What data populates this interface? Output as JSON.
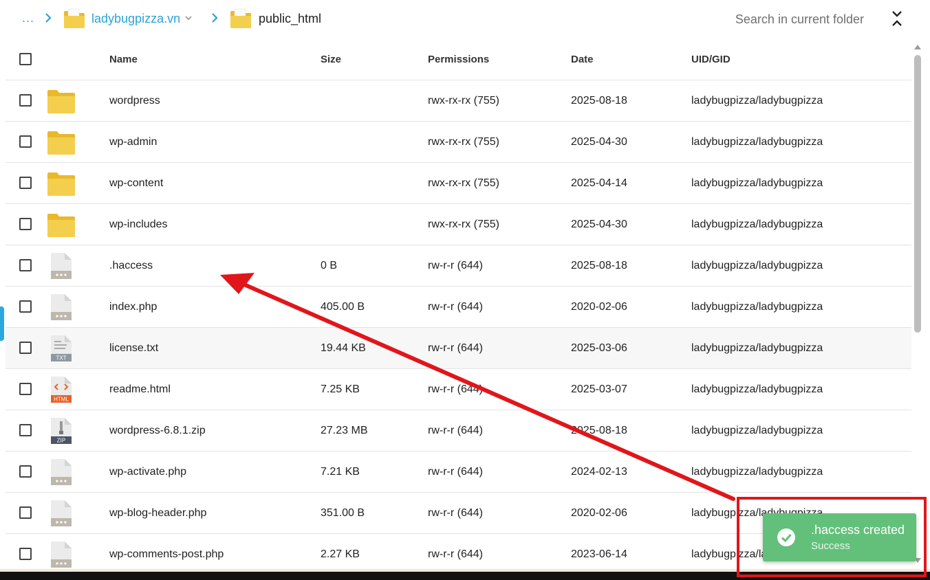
{
  "breadcrumb": {
    "ellipsis": "...",
    "domain": "ladybugpizza.vn",
    "current": "public_html"
  },
  "search": {
    "placeholder": "Search in current folder"
  },
  "columns": {
    "name": "Name",
    "size": "Size",
    "permissions": "Permissions",
    "date": "Date",
    "uid_gid": "UID/GID"
  },
  "files": [
    {
      "icon": "folder-icon",
      "name": "wordpress",
      "size": "",
      "permissions": "rwx-rx-rx (755)",
      "date": "2025-08-18",
      "uid": "ladybugpizza/ladybugpizza"
    },
    {
      "icon": "folder-icon",
      "name": "wp-admin",
      "size": "",
      "permissions": "rwx-rx-rx (755)",
      "date": "2025-04-30",
      "uid": "ladybugpizza/ladybugpizza"
    },
    {
      "icon": "folder-icon",
      "name": "wp-content",
      "size": "",
      "permissions": "rwx-rx-rx (755)",
      "date": "2025-04-14",
      "uid": "ladybugpizza/ladybugpizza"
    },
    {
      "icon": "folder-icon",
      "name": "wp-includes",
      "size": "",
      "permissions": "rwx-rx-rx (755)",
      "date": "2025-04-30",
      "uid": "ladybugpizza/ladybugpizza"
    },
    {
      "icon": "generic-file-icon",
      "name": ".haccess",
      "size": "0 B",
      "permissions": "rw-r-r (644)",
      "date": "2025-08-18",
      "uid": "ladybugpizza/ladybugpizza"
    },
    {
      "icon": "generic-file-icon",
      "name": "index.php",
      "size": "405.00 B",
      "permissions": "rw-r-r (644)",
      "date": "2020-02-06",
      "uid": "ladybugpizza/ladybugpizza"
    },
    {
      "icon": "txt-file-icon",
      "name": "license.txt",
      "size": "19.44 KB",
      "permissions": "rw-r-r (644)",
      "date": "2025-03-06",
      "uid": "ladybugpizza/ladybugpizza",
      "badge": "TXT"
    },
    {
      "icon": "html-file-icon",
      "name": "readme.html",
      "size": "7.25 KB",
      "permissions": "rw-r-r (644)",
      "date": "2025-03-07",
      "uid": "ladybugpizza/ladybugpizza",
      "badge": "HTML"
    },
    {
      "icon": "zip-file-icon",
      "name": "wordpress-6.8.1.zip",
      "size": "27.23 MB",
      "permissions": "rw-r-r (644)",
      "date": "2025-08-18",
      "uid": "ladybugpizza/ladybugpizza",
      "badge": "ZIP"
    },
    {
      "icon": "generic-file-icon",
      "name": "wp-activate.php",
      "size": "7.21 KB",
      "permissions": "rw-r-r (644)",
      "date": "2024-02-13",
      "uid": "ladybugpizza/ladybugpizza"
    },
    {
      "icon": "generic-file-icon",
      "name": "wp-blog-header.php",
      "size": "351.00 B",
      "permissions": "rw-r-r (644)",
      "date": "2020-02-06",
      "uid": "ladybugpizza/ladybugpizza"
    },
    {
      "icon": "generic-file-icon",
      "name": "wp-comments-post.php",
      "size": "2.27 KB",
      "permissions": "rw-r-r (644)",
      "date": "2023-06-14",
      "uid": "ladybugpizza/ladybugpizza"
    }
  ],
  "toast": {
    "title": ".haccess created",
    "subtitle": "Success",
    "icon": "check-circle-icon"
  },
  "colors": {
    "link": "#2aa3d9",
    "folder": "#f3cf4d",
    "folder_tab": "#e9b92c",
    "toast": "#62c07a",
    "annotation": "#e0161b",
    "html_badge": "#e7612a",
    "zip_badge": "#4b5566",
    "txt_badge": "#8e98a0"
  }
}
